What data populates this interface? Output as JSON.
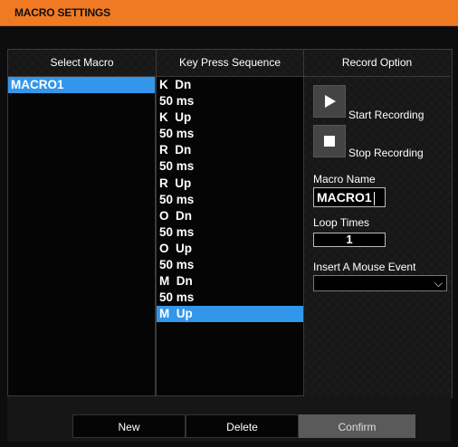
{
  "window": {
    "title": "MACRO SETTINGS"
  },
  "columns": {
    "select_macro": "Select Macro",
    "key_press_sequence": "Key Press Sequence",
    "record_option": "Record Option"
  },
  "macros": [
    "MACRO1"
  ],
  "selected_macro": "MACRO1",
  "sequence": [
    "K  Dn",
    "50 ms",
    "K  Up",
    "50 ms",
    "R  Dn",
    "50 ms",
    "R  Up",
    "50 ms",
    "O  Dn",
    "50 ms",
    "O  Up",
    "50 ms",
    "M  Dn",
    "50 ms",
    "M  Up"
  ],
  "selected_sequence_index": 14,
  "record": {
    "start_label": "Start Recording",
    "stop_label": "Stop Recording",
    "start_icon": "play-icon",
    "stop_icon": "stop-icon"
  },
  "macro_name": {
    "label": "Macro Name",
    "value": "MACRO1"
  },
  "loop_times": {
    "label": "Loop Times",
    "value": "1"
  },
  "mouse_event": {
    "label": "Insert A Mouse Event",
    "value": "",
    "icon": "chevron-down-icon"
  },
  "buttons": {
    "new": "New",
    "delete": "Delete",
    "confirm": "Confirm"
  },
  "colors": {
    "accent": "#f07a24",
    "selection": "#3296ea",
    "background": "#0d0d0d"
  }
}
